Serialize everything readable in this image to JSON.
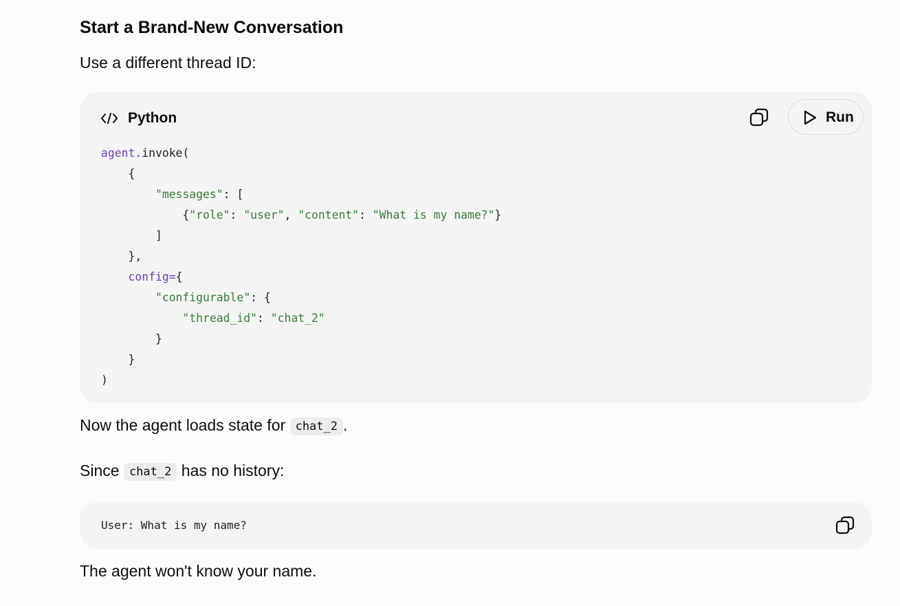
{
  "section_title": "Start a Brand-New Conversation",
  "intro_text": "Use a different thread ID:",
  "code_block": {
    "language": "Python",
    "run_label": "Run",
    "lines": [
      [
        {
          "t": "var",
          "v": "agent"
        },
        {
          "t": "var",
          "v": "."
        },
        {
          "t": "pun",
          "v": "invoke("
        }
      ],
      [
        {
          "t": "pun",
          "v": "    {"
        }
      ],
      [
        {
          "t": "pun",
          "v": "        "
        },
        {
          "t": "str",
          "v": "\"messages\""
        },
        {
          "t": "pun",
          "v": ": ["
        }
      ],
      [
        {
          "t": "pun",
          "v": "            {"
        },
        {
          "t": "str",
          "v": "\"role\""
        },
        {
          "t": "pun",
          "v": ": "
        },
        {
          "t": "str",
          "v": "\"user\""
        },
        {
          "t": "pun",
          "v": ", "
        },
        {
          "t": "str",
          "v": "\"content\""
        },
        {
          "t": "pun",
          "v": ": "
        },
        {
          "t": "str",
          "v": "\"What is my name?\""
        },
        {
          "t": "pun",
          "v": "}"
        }
      ],
      [
        {
          "t": "pun",
          "v": "        ]"
        }
      ],
      [
        {
          "t": "pun",
          "v": "    },"
        }
      ],
      [
        {
          "t": "pun",
          "v": "    "
        },
        {
          "t": "var",
          "v": "config"
        },
        {
          "t": "var",
          "v": "="
        },
        {
          "t": "pun",
          "v": "{"
        }
      ],
      [
        {
          "t": "pun",
          "v": "        "
        },
        {
          "t": "str",
          "v": "\"configurable\""
        },
        {
          "t": "pun",
          "v": ": {"
        }
      ],
      [
        {
          "t": "pun",
          "v": "            "
        },
        {
          "t": "str",
          "v": "\"thread_id\""
        },
        {
          "t": "pun",
          "v": ": "
        },
        {
          "t": "str",
          "v": "\"chat_2\""
        }
      ],
      [
        {
          "t": "pun",
          "v": "        }"
        }
      ],
      [
        {
          "t": "pun",
          "v": "    }"
        }
      ],
      [
        {
          "t": "pun",
          "v": ")"
        }
      ]
    ]
  },
  "loads_text": {
    "before": "Now the agent loads state for ",
    "code": "chat_2",
    "after": "."
  },
  "since_text": {
    "before": "Since ",
    "code": "chat_2",
    "after": " has no history:"
  },
  "output_block": {
    "text": "User: What is my name?"
  },
  "final_text": "The agent won't know your name.",
  "colors": {
    "background": "#fcfcfc",
    "code_background": "#f4f4f4",
    "keyword": "#6f42a8",
    "string": "#3b7a3b"
  },
  "icons": {
    "language": "code-icon",
    "copy": "copy-icon",
    "run": "play-icon"
  }
}
